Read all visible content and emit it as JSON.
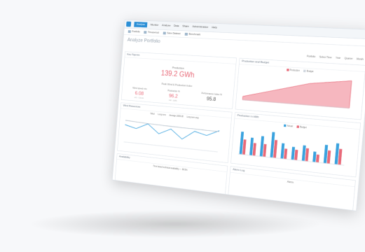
{
  "ribbon": {
    "file": "Analyse",
    "tabs": [
      "Monitor",
      "Analyse",
      "Data",
      "Share",
      "Administration",
      "Help"
    ]
  },
  "toolbar": {
    "items": [
      "Portfolio",
      "Timeperiod",
      "Save Dataset",
      "Benchmark"
    ]
  },
  "page": {
    "title": "Analyze Portfolio"
  },
  "subbar": {
    "items": [
      "Portfolio",
      "Select Time",
      "Year",
      "Quarter",
      "Month"
    ]
  },
  "panels": {
    "key_figures": {
      "title": "Key Figures",
      "production_label": "Production",
      "production_value": "139.2 GWh",
      "section_label": "Peak Wind & Production Index",
      "kpis": [
        {
          "label": "Wind speed m/s",
          "value": "6.08",
          "delta": "-0.1 · 1.4 m/s"
        },
        {
          "label": "Production %",
          "value": "96.2",
          "delta": "0.8 · -0.8%"
        },
        {
          "label": "Performance Index %",
          "value": "95.8",
          "delta": ""
        }
      ]
    },
    "production_chart": {
      "title": "Production and Budget",
      "legend": [
        "Production",
        "Budget"
      ]
    },
    "wind_chart": {
      "title": "Wind Resources",
      "legend": [
        "Wind",
        "Long term",
        "Average 2005-08",
        "Long term avg"
      ]
    },
    "bar_chart": {
      "title": "Production in kWh",
      "legend": [
        "Actual",
        "Budget"
      ]
    },
    "availability": {
      "title": "Availability",
      "legend_text": "Time based technical availability — 98.5%"
    },
    "alarm_panel": {
      "title": "Alarm Log",
      "legend_text": "Alarms"
    }
  },
  "colors": {
    "accent": "#2b8fd6",
    "red": "#e86a79",
    "blue": "#3aa2de"
  },
  "chart_data": [
    {
      "type": "area",
      "series": [
        {
          "name": "Production",
          "values": [
            2,
            4,
            6,
            8,
            10,
            12,
            13,
            14,
            15
          ]
        }
      ]
    },
    {
      "type": "line",
      "series": [
        {
          "name": "Wind",
          "values": [
            6,
            5,
            7,
            4,
            6,
            3,
            6,
            5,
            7
          ]
        },
        {
          "name": "Long term",
          "values": [
            7.5,
            7.3,
            7.1,
            7.0,
            6.9,
            6.8,
            6.8,
            6.7,
            6.7
          ]
        }
      ]
    },
    {
      "type": "bar",
      "categories": [
        "1",
        "2",
        "3",
        "4",
        "5",
        "6",
        "7",
        "8",
        "9",
        "10"
      ],
      "series": [
        {
          "name": "Actual",
          "values": [
            9,
            7,
            8,
            10,
            6,
            5,
            6,
            4,
            7,
            8
          ]
        },
        {
          "name": "Budget",
          "values": [
            6,
            5,
            5,
            7,
            4,
            4,
            5,
            3,
            5,
            6
          ]
        }
      ]
    }
  ]
}
